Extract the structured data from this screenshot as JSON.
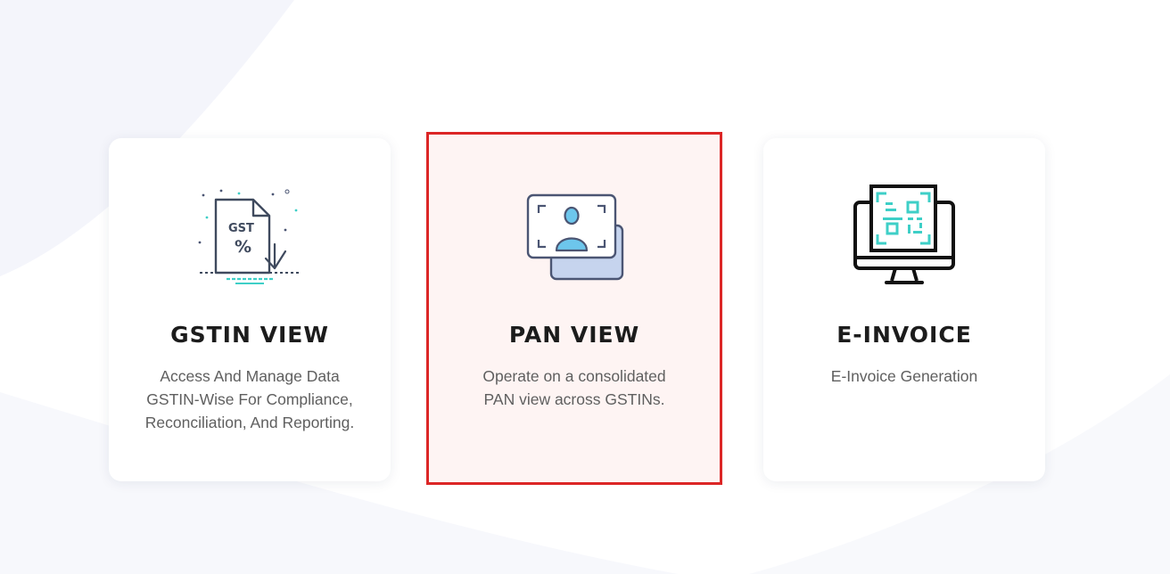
{
  "cards": [
    {
      "title": "GSTIN VIEW",
      "description_lines": [
        "Access And Manage Data",
        "GSTIN-Wise For Compliance,",
        "Reconciliation, And Reporting."
      ],
      "icon": "gst-document-icon",
      "icon_text": "GST",
      "selected": false
    },
    {
      "title": "PAN VIEW",
      "description_lines": [
        "Operate on a consolidated",
        "PAN view across GSTINs."
      ],
      "icon": "pan-card-icon",
      "selected": true
    },
    {
      "title": "E-INVOICE",
      "description_lines": [
        "E-Invoice Generation"
      ],
      "icon": "qr-monitor-icon",
      "selected": false
    }
  ],
  "colors": {
    "selected_border": "#dc2626",
    "selected_background": "#fef4f3",
    "icon_teal": "#3ecfc7",
    "icon_blue": "#6dc6ec",
    "icon_outline": "#4b5573"
  }
}
